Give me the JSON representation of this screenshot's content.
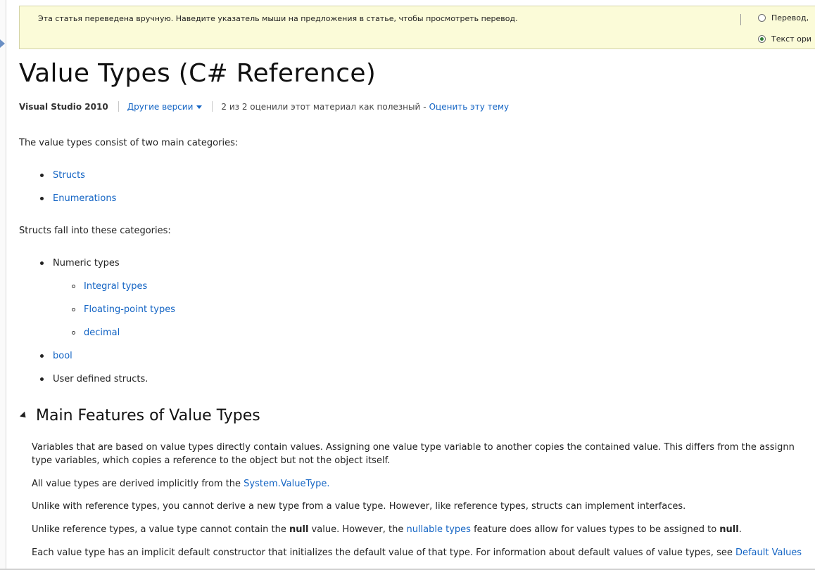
{
  "banner": {
    "text": "Эта статья переведена вручную. Наведите указатель мыши на предложения в статье, чтобы просмотреть перевод.",
    "option_translation": "Перевод",
    "option_translation_suffix": ",",
    "option_original": "Текст ори",
    "selected": "original"
  },
  "page_title": "Value Types (C# Reference)",
  "meta": {
    "product": "Visual Studio 2010",
    "other_versions": "Другие версии",
    "rating": "2 из 2 оценили этот материал как полезный",
    "dash": "-",
    "rate_link": "Оценить эту тему"
  },
  "intro": "The value types consist of two main categories:",
  "categories": [
    "Structs",
    "Enumerations"
  ],
  "structs_intro": "Structs fall into these categories:",
  "struct_items": {
    "numeric": "Numeric types",
    "numeric_children": [
      "Integral types",
      "Floating-point types",
      "decimal"
    ],
    "bool": "bool",
    "user_defined": "User defined structs."
  },
  "section": {
    "title": "Main Features of Value Types",
    "p1_line1": "Variables that are based on value types directly contain values. Assigning one value type variable to another copies the contained value. This differs from the assignn",
    "p1_line2": "type variables, which copies a reference to the object but not the object itself.",
    "p2_pre": "All value types are derived implicitly from the ",
    "p2_link": "System.ValueType.",
    "p3": "Unlike with reference types, you cannot derive a new type from a value type. However, like reference types, structs can implement interfaces.",
    "p4_pre": "Unlike reference types, a value type cannot contain the ",
    "p4_bold1": "null",
    "p4_mid1": " value. However, the ",
    "p4_link": "nullable types",
    "p4_mid2": " feature does allow for values types to be assigned to ",
    "p4_bold2": "null",
    "p4_end": ".",
    "p5_pre": "Each value type has an implicit default constructor that initializes the default value of that type. For information about default values of value types, see ",
    "p5_link": "Default Values"
  },
  "colors": {
    "link": "#1364c4",
    "banner_bg": "#fbfbd8"
  }
}
